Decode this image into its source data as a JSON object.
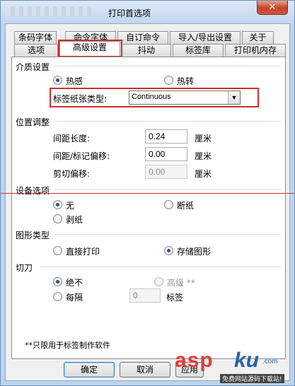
{
  "window": {
    "title": "打印首选项",
    "close_label": "✕"
  },
  "tabs_row1": [
    {
      "label": "条码字体"
    },
    {
      "label": "命令字体"
    },
    {
      "label": "自订命令"
    },
    {
      "label": "导入/导出设置"
    },
    {
      "label": "关于"
    }
  ],
  "tabs_row2": [
    {
      "label": "选项"
    },
    {
      "label": "高级设置",
      "active": true
    },
    {
      "label": "抖动"
    },
    {
      "label": "标签库"
    },
    {
      "label": "打印机内存"
    }
  ],
  "media": {
    "group_label": "介质设置",
    "thermal_label": "热感",
    "thermal_transfer_label": "热转",
    "selected": "热感",
    "label_type_label": "标签纸张类型:",
    "label_type_value": "Continuous"
  },
  "position": {
    "group_label": "位置调整",
    "gap_label": "间距长度:",
    "gap_value": "0.24",
    "offset_label": "间距/标记偏移:",
    "offset_value": "0.00",
    "cut_label": "剪切偏移:",
    "cut_value": "0.00",
    "unit": "厘米"
  },
  "device": {
    "group_label": "设备选项",
    "none_label": "无",
    "tear_label": "断纸",
    "peel_label": "剥纸",
    "selected": "无"
  },
  "graphics": {
    "group_label": "图形类型",
    "direct_label": "直接打印",
    "stored_label": "存储图形",
    "selected": "存储图形"
  },
  "cutter": {
    "group_label": "切刀",
    "never_label": "绝不",
    "advanced_label": "高级 **",
    "every_label": "每隔",
    "every_value": "0",
    "every_unit": "标签",
    "selected": "绝不"
  },
  "note": "**只限用于标签制作软件",
  "buttons": {
    "ok": "确定",
    "cancel": "取消",
    "apply": "应用"
  },
  "watermark": {
    "asp": "asp",
    "ku": "ku",
    "com": ".com",
    "sub": "免费网站源码下载站!"
  },
  "colors": {
    "annotation_red": "#d22c2c",
    "window_frame": "#bcd4ee",
    "radio_dot": "#1f4f9a"
  }
}
